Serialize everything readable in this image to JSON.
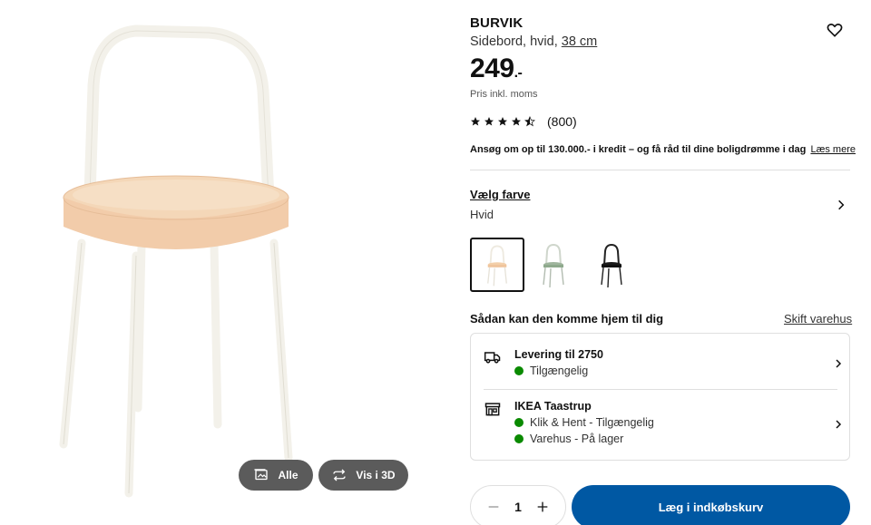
{
  "gallery": {
    "all_label": "Alle",
    "view3d_label": "Vis i 3D"
  },
  "product": {
    "brand": "BURVIK",
    "description": "Sidebord, hvid,",
    "size": "38 cm",
    "price_main": "249",
    "price_decimal": ".-",
    "price_note": "Pris inkl. moms",
    "rating_value": 4.5,
    "rating_count": "(800)"
  },
  "credit": {
    "text": "Ansøg om op til 130.000.- i kredit – og få råd til dine boligdrømme i dag",
    "link": "Læs mere"
  },
  "color": {
    "title": "Vælg farve",
    "selected": "Hvid",
    "options": [
      "white-birch",
      "green",
      "black"
    ]
  },
  "delivery": {
    "title": "Sådan kan den komme hjem til dig",
    "change_store": "Skift varehus",
    "shipping_title": "Levering til 2750",
    "shipping_status": "Tilgængelig",
    "store_title": "IKEA Taastrup",
    "store_status_1": "Klik & Hent - Tilgængelig",
    "store_status_2": "Varehus - På lager"
  },
  "cart": {
    "quantity": "1",
    "button_label": "Læg i indkøbskurv"
  },
  "colors": {
    "accent": "#0058a3",
    "available": "#0a8a00",
    "gallery_btn": "#5b5b5b"
  }
}
